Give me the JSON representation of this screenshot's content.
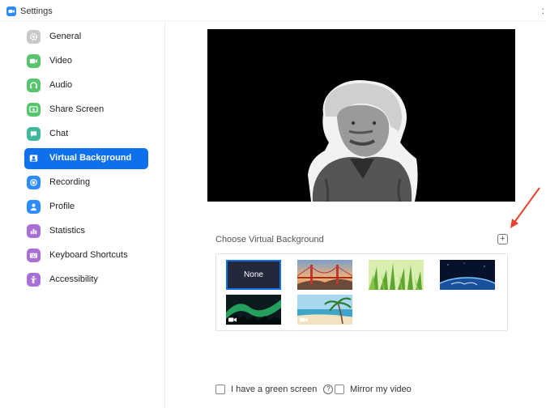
{
  "window": {
    "title": "Settings",
    "close_glyph": ":"
  },
  "sidebar": {
    "items": [
      {
        "label": "General",
        "icon": "gear-icon",
        "color": "#c8c8c8"
      },
      {
        "label": "Video",
        "icon": "video-camera-icon",
        "color": "#58c46e"
      },
      {
        "label": "Audio",
        "icon": "headphones-icon",
        "color": "#58c46e"
      },
      {
        "label": "Share Screen",
        "icon": "share-screen-icon",
        "color": "#58c46e"
      },
      {
        "label": "Chat",
        "icon": "chat-bubble-icon",
        "color": "#3fb89d"
      },
      {
        "label": "Virtual Background",
        "icon": "person-frame-icon",
        "color": "#ffffff",
        "active": true
      },
      {
        "label": "Recording",
        "icon": "record-icon",
        "color": "#2d8cff"
      },
      {
        "label": "Profile",
        "icon": "person-icon",
        "color": "#2d8cff"
      },
      {
        "label": "Statistics",
        "icon": "bar-chart-icon",
        "color": "#a86fd6"
      },
      {
        "label": "Keyboard Shortcuts",
        "icon": "keyboard-icon",
        "color": "#a86fd6"
      },
      {
        "label": "Accessibility",
        "icon": "accessibility-icon",
        "color": "#a86fd6"
      }
    ]
  },
  "main": {
    "section_title": "Choose Virtual Background",
    "add_glyph": "+",
    "backgrounds": [
      {
        "name": "None",
        "kind": "none",
        "selected": true
      },
      {
        "name": "Golden Gate Bridge",
        "kind": "bridge",
        "selected": false
      },
      {
        "name": "Grass",
        "kind": "grass",
        "selected": false
      },
      {
        "name": "Earth from space",
        "kind": "earth",
        "selected": false
      },
      {
        "name": "Aurora",
        "kind": "aurora",
        "selected": false,
        "video": true
      },
      {
        "name": "Beach",
        "kind": "beach",
        "selected": false,
        "video": true
      }
    ],
    "options": {
      "green_screen": {
        "label": "I have a green screen",
        "checked": false
      },
      "help_glyph": "?",
      "mirror_video": {
        "label": "Mirror my video",
        "checked": false
      }
    }
  },
  "colors": {
    "accent": "#0e71eb",
    "arrow": "#e8412c"
  }
}
